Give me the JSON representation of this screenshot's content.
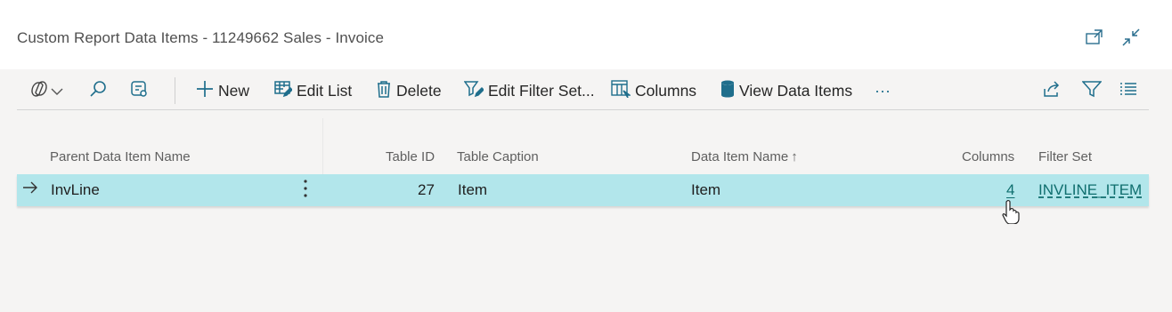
{
  "window": {
    "title": "Custom Report Data Items - 11249662 Sales - Invoice"
  },
  "toolbar": {
    "new_label": "New",
    "edit_list_label": "Edit List",
    "delete_label": "Delete",
    "edit_filter_set_label": "Edit Filter Set...",
    "columns_label": "Columns",
    "view_data_items_label": "View Data Items",
    "more_label": "···"
  },
  "table": {
    "columns": [
      "Parent Data Item Name",
      "Table ID",
      "Table Caption",
      "Data Item Name",
      "Columns",
      "Filter Set"
    ],
    "sort_indicator": "↑",
    "rows": [
      {
        "parent_data_item_name": "InvLine",
        "table_id": "27",
        "table_caption": "Item",
        "data_item_name": "Item",
        "columns": "4",
        "filter_set": "INVLINE_ITEM"
      }
    ]
  },
  "colors": {
    "accent": "#1f6e8c",
    "selected_row": "#b2e6eb",
    "page_background": "#f5f4f3"
  },
  "icons": [
    "open-in-new-window-icon",
    "collapse-icon",
    "copilot-icon",
    "chevron-down-icon",
    "search-icon",
    "personalize-icon",
    "plus-icon",
    "edit-list-icon",
    "trash-icon",
    "edit-filter-icon",
    "columns-icon",
    "database-icon",
    "share-icon",
    "filter-icon",
    "list-view-icon",
    "arrow-right-icon",
    "row-menu-icon",
    "hand-cursor-icon"
  ]
}
